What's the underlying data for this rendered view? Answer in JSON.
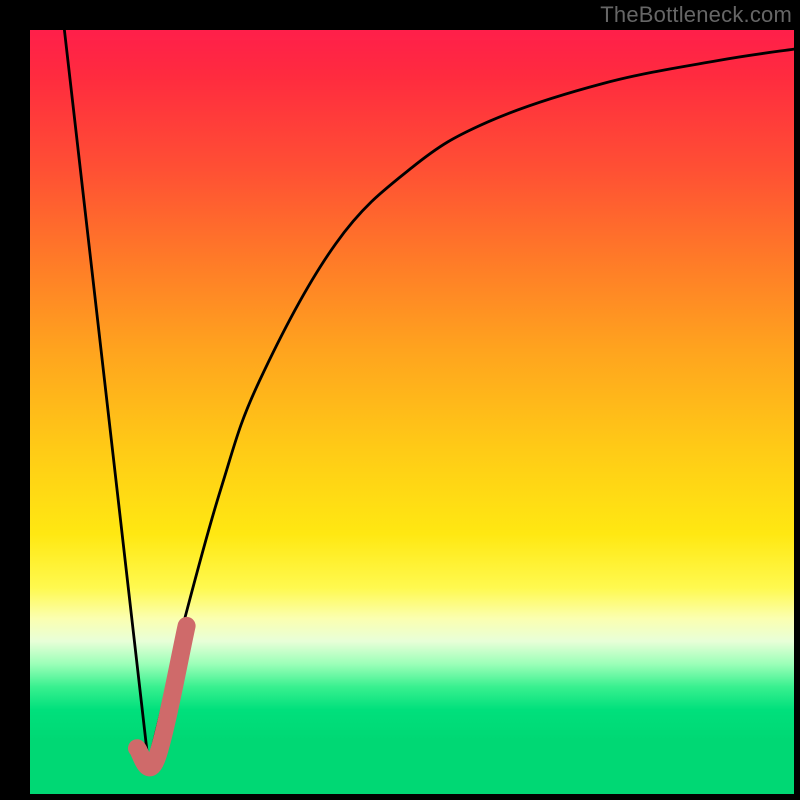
{
  "attribution": "TheBottleneck.com",
  "chart_data": {
    "type": "line",
    "title": "",
    "xlabel": "",
    "ylabel": "",
    "x_range": [
      0,
      100
    ],
    "y_range": [
      0,
      100
    ],
    "series": [
      {
        "name": "left-line",
        "values": [
          {
            "x": 4.5,
            "y": 100
          },
          {
            "x": 15.5,
            "y": 4
          }
        ]
      },
      {
        "name": "right-curve",
        "values": [
          {
            "x": 15.5,
            "y": 4
          },
          {
            "x": 20,
            "y": 22
          },
          {
            "x": 25,
            "y": 40
          },
          {
            "x": 30,
            "y": 54
          },
          {
            "x": 40,
            "y": 72
          },
          {
            "x": 50,
            "y": 82
          },
          {
            "x": 60,
            "y": 88
          },
          {
            "x": 75,
            "y": 93
          },
          {
            "x": 90,
            "y": 96
          },
          {
            "x": 100,
            "y": 97.5
          }
        ]
      },
      {
        "name": "highlight-segment",
        "values": [
          {
            "x": 14,
            "y": 6
          },
          {
            "x": 16.5,
            "y": 4.5
          },
          {
            "x": 20.5,
            "y": 22
          }
        ]
      }
    ],
    "background_gradient": {
      "top": "#ff1f4a",
      "mid": "#ffe812",
      "bottom": "#00d874"
    }
  }
}
